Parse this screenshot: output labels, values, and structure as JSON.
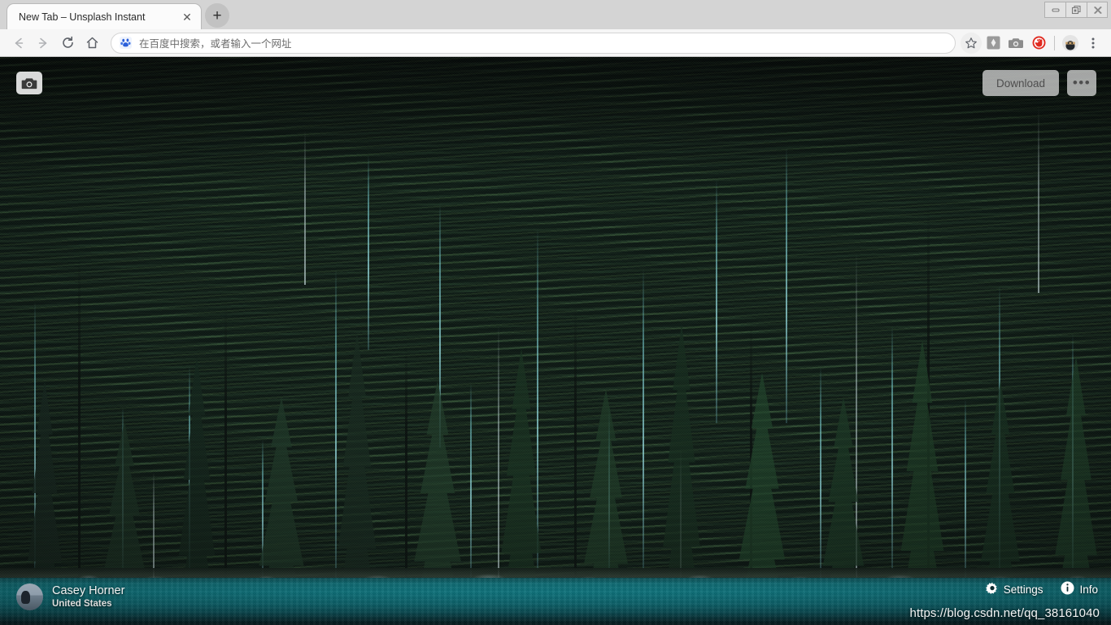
{
  "window": {
    "controls": [
      {
        "name": "minimize",
        "glyph": "–"
      },
      {
        "name": "restore",
        "glyph": "❐"
      },
      {
        "name": "close",
        "glyph": "✕"
      }
    ]
  },
  "tabs": [
    {
      "title": "New Tab – Unsplash Instant",
      "close_label": "✕",
      "active": true
    }
  ],
  "newtab": {
    "label": "+"
  },
  "toolbar": {
    "back_label": "←",
    "forward_label": "→",
    "reload_label": "↻",
    "home_label": "⌂",
    "bookmark_label": "☆",
    "extension_1_label": "◆",
    "extension_camera_label": "◉",
    "extension_adblock_label": "✋",
    "profile_label": "●",
    "menu_label": "⋮"
  },
  "omnibox": {
    "placeholder": "在百度中搜索，或者输入一个网址",
    "value": "",
    "engine_icon": "baidu-paw-icon"
  },
  "page": {
    "logo": "camera-icon",
    "download_label": "Download",
    "more_label": "•••",
    "author": {
      "name": "Casey Horner",
      "location": "United States"
    },
    "settings_label": "Settings",
    "info_label": "Info",
    "watermark": "https://blog.csdn.net/qq_38161040"
  },
  "colors": {
    "tabstrip_bg": "#d4d4d4",
    "toolbar_bg": "#f6f6f6",
    "active_tab_bg": "#fbfbfb",
    "water_teal": "#0f8e99",
    "forest_dark": "#0d1713",
    "accent_baidu": "#2b5fd9",
    "adblock_red": "#e02a20"
  }
}
